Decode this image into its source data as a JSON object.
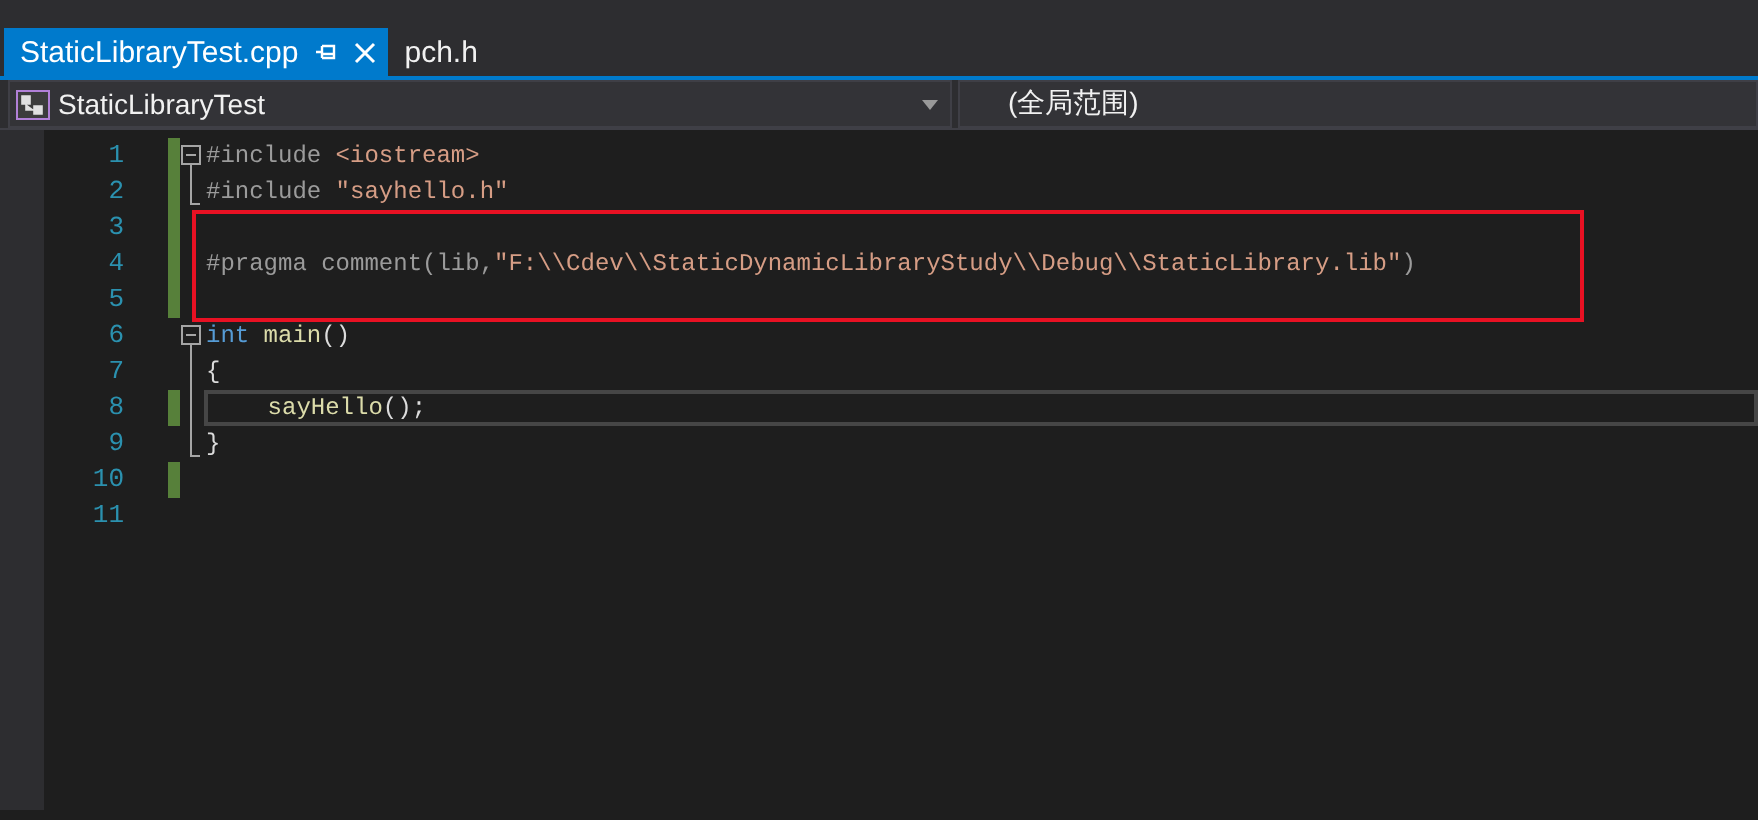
{
  "tabs": [
    {
      "label": "StaticLibraryTest.cpp",
      "selected": true,
      "pinned": true,
      "closable": true
    },
    {
      "label": "pch.h",
      "selected": false,
      "pinned": false,
      "closable": false
    }
  ],
  "navigation": {
    "project": "StaticLibraryTest",
    "scope": "(全局范围)"
  },
  "lines": [
    {
      "number": "1",
      "changed": true,
      "boxed": false,
      "current": false,
      "tokens": [
        {
          "kind": "directive",
          "text": "#include"
        },
        {
          "kind": "string",
          "text": " <iostream>"
        }
      ],
      "children": [
        {
          "number": "2",
          "changed": true,
          "boxed": false,
          "current": false,
          "tokens": [
            {
              "kind": "directive",
              "text": "#include"
            },
            {
              "kind": "string",
              "text": " \"sayhello.h\""
            }
          ]
        }
      ]
    },
    {
      "number": "3",
      "changed": true,
      "boxed": true,
      "current": false
    },
    {
      "number": "4",
      "changed": true,
      "boxed": true,
      "current": false,
      "tokens": [
        {
          "kind": "directive",
          "text": "#pragma comment(lib,"
        },
        {
          "kind": "string",
          "text": "\"F:\\\\Cdev\\\\StaticDynamicLibraryStudy\\\\Debug\\\\StaticLibrary.lib\""
        },
        {
          "kind": "directive",
          "text": ")"
        }
      ]
    },
    {
      "number": "5",
      "changed": true,
      "boxed": true,
      "current": false
    },
    {
      "number": "6",
      "changed": false,
      "boxed": false,
      "current": false,
      "tokens": [
        {
          "kind": "keyword",
          "text": "int"
        },
        {
          "kind": "function",
          "text": " main"
        },
        {
          "kind": "plain",
          "text": "()"
        }
      ],
      "children": [
        {
          "number": "7",
          "changed": false,
          "boxed": false,
          "current": false,
          "tokens": [
            {
              "kind": "plain",
              "text": "{"
            }
          ]
        },
        {
          "number": "8",
          "changed": true,
          "boxed": false,
          "current": true,
          "tokens": [
            {
              "kind": "function",
              "text": "    sayHello"
            },
            {
              "kind": "plain",
              "text": "();"
            }
          ]
        },
        {
          "number": "9",
          "changed": false,
          "boxed": false,
          "current": false,
          "tokens": [
            {
              "kind": "plain",
              "text": "}"
            }
          ]
        }
      ]
    },
    {
      "number": "10",
      "changed": true,
      "boxed": false,
      "current": false
    },
    {
      "number": "11",
      "changed": false,
      "boxed": false,
      "current": false
    }
  ]
}
